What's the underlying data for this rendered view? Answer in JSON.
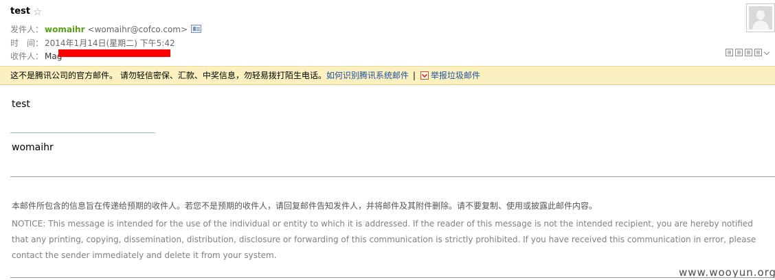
{
  "header": {
    "subject": "test",
    "from_label": "发件人：",
    "from_name": "womaihr",
    "from_email": "<womaihr@cofco.com>",
    "time_label": "时　间：",
    "time_value": "2014年1月14日(星期二) 下午5:42",
    "to_label": "收件人：",
    "to_value": "Mag"
  },
  "notice": {
    "text": "这不是腾讯公司的官方邮件。 请勿轻信密保、汇款、中奖信息，勿轻易拨打陌生电话。",
    "link": "如何识别腾讯系统邮件",
    "separator": "|",
    "report": "举报垃圾邮件"
  },
  "body": {
    "greeting": "test",
    "signature": "womaihr",
    "disclaimer_cn": "本邮件所包含的信息旨在传递给预期的收件人。若您不是预期的收件人，请回复邮件告知发件人，并将邮件及其附件删除。请不要复制、使用或披露此邮件内容。",
    "disclaimer_en": "NOTICE: This message is intended for the use of the individual or entity to which it is addressed. If the reader of this message is not the intended recipient, you are hereby notified that any printing, copying, dissemination, distribution, disclosure or forwarding of this communication is strictly prohibited. If you have received this communication in error, please contact the sender immediately and delete it from your system."
  },
  "watermark": "www.wooyun.org",
  "icons": {
    "star": "star-icon",
    "contact_card": "contact-card-icon",
    "avatar": "avatar-placeholder",
    "report": "report-spam-icon"
  },
  "colors": {
    "sender_name": "#57a017",
    "notice_bg": "#fbf0c0",
    "link": "#1f4fa1",
    "redaction": "#ff0000"
  }
}
